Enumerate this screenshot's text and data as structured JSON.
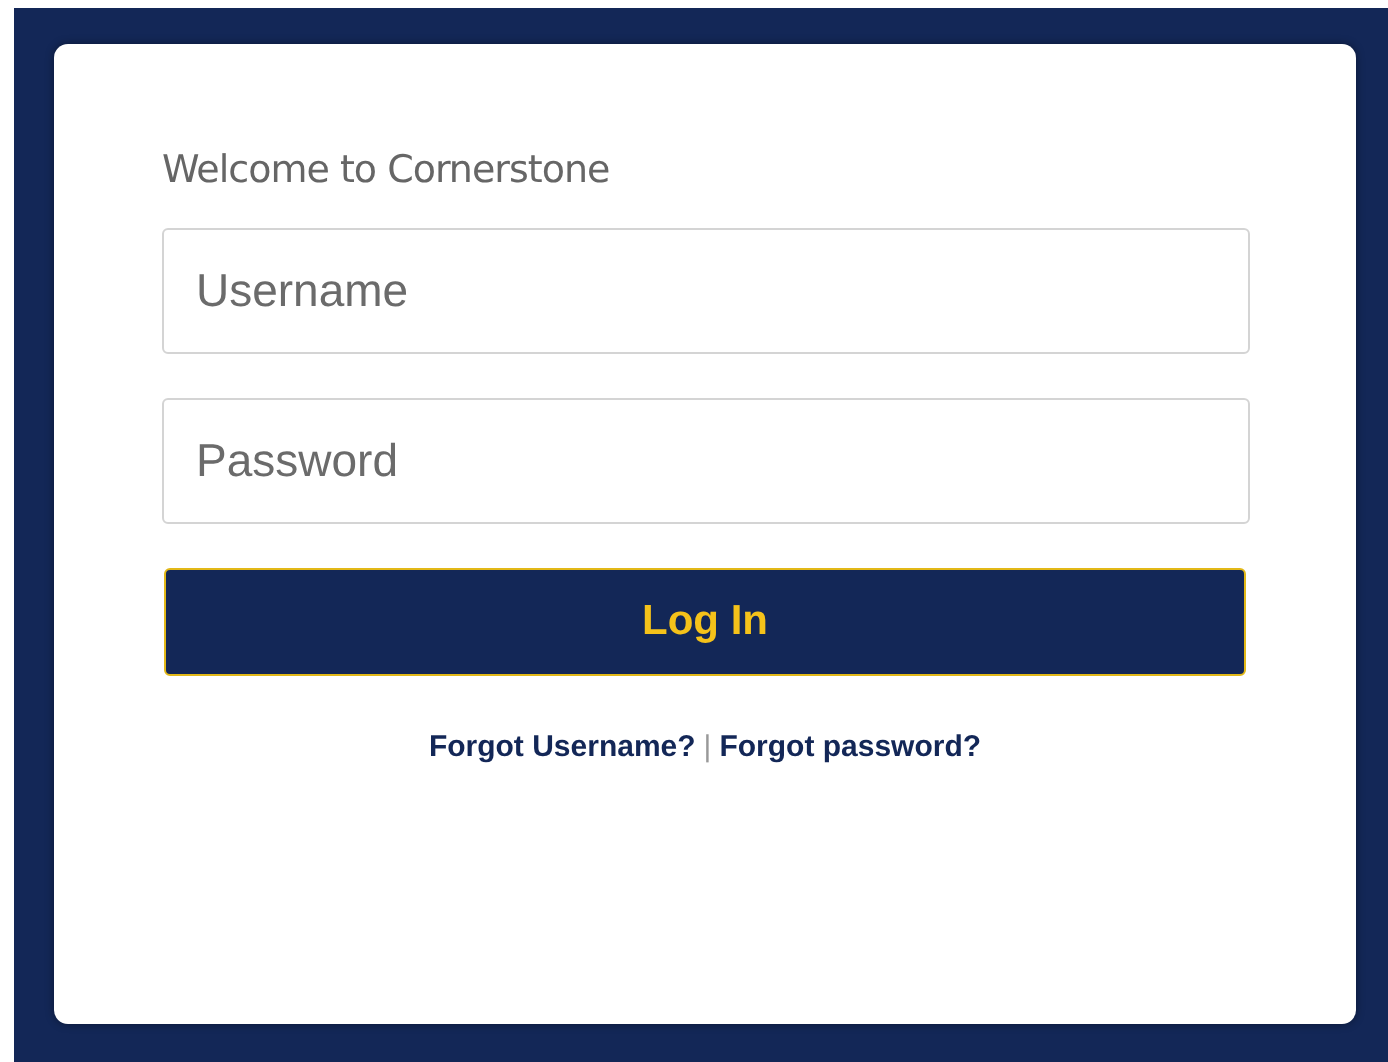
{
  "welcome": "Welcome to Cornerstone",
  "fields": [
    {
      "placeholder": "Username"
    },
    {
      "placeholder": "Password"
    }
  ],
  "login_button": "Log In",
  "links": [
    {
      "label": "Forgot Username?"
    },
    {
      "label": "Forgot password?"
    }
  ],
  "link_separator": "|"
}
